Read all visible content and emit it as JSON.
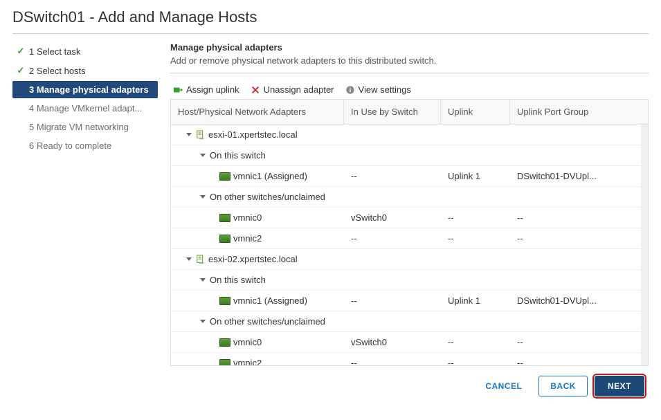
{
  "title": "DSwitch01 - Add and Manage Hosts",
  "sidebar": {
    "steps": [
      {
        "num": "1",
        "label": "Select task",
        "state": "done"
      },
      {
        "num": "2",
        "label": "Select hosts",
        "state": "done"
      },
      {
        "num": "3",
        "label": "Manage physical adapters",
        "state": "current"
      },
      {
        "num": "4",
        "label": "Manage VMkernel adapt...",
        "state": "pending"
      },
      {
        "num": "5",
        "label": "Migrate VM networking",
        "state": "pending"
      },
      {
        "num": "6",
        "label": "Ready to complete",
        "state": "pending"
      }
    ]
  },
  "section": {
    "title": "Manage physical adapters",
    "desc": "Add or remove physical network adapters to this distributed switch."
  },
  "toolbar": {
    "assign": "Assign uplink",
    "unassign": "Unassign adapter",
    "view": "View settings"
  },
  "columns": {
    "c1": "Host/Physical Network Adapters",
    "c2": "In Use by Switch",
    "c3": "Uplink",
    "c4": "Uplink Port Group"
  },
  "rows": [
    {
      "kind": "host",
      "label": "esxi-01.xpertstec.local"
    },
    {
      "kind": "group-on",
      "label": "On this switch"
    },
    {
      "kind": "nic",
      "label": "vmnic1 (Assigned)",
      "inuse": "--",
      "uplink": "Uplink 1",
      "upg": "DSwitch01-DVUpl..."
    },
    {
      "kind": "group-other",
      "label": "On other switches/unclaimed"
    },
    {
      "kind": "nic",
      "label": "vmnic0",
      "inuse": "vSwitch0",
      "uplink": "--",
      "upg": "--"
    },
    {
      "kind": "nic",
      "label": "vmnic2",
      "inuse": "--",
      "uplink": "--",
      "upg": "--"
    },
    {
      "kind": "host",
      "label": "esxi-02.xpertstec.local"
    },
    {
      "kind": "group-on",
      "label": "On this switch"
    },
    {
      "kind": "nic",
      "label": "vmnic1 (Assigned)",
      "inuse": "--",
      "uplink": "Uplink 1",
      "upg": "DSwitch01-DVUpl..."
    },
    {
      "kind": "group-other",
      "label": "On other switches/unclaimed"
    },
    {
      "kind": "nic",
      "label": "vmnic0",
      "inuse": "vSwitch0",
      "uplink": "--",
      "upg": "--"
    },
    {
      "kind": "nic",
      "label": "vmnic2",
      "inuse": "--",
      "uplink": "--",
      "upg": "--"
    }
  ],
  "footer": {
    "cancel": "CANCEL",
    "back": "BACK",
    "next": "NEXT"
  }
}
